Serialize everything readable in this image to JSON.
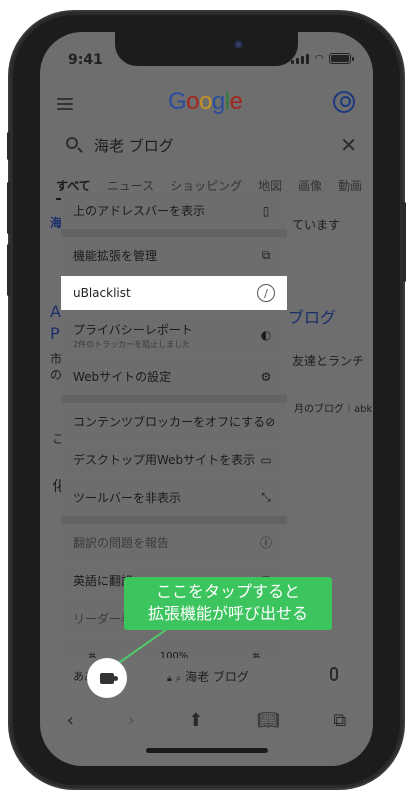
{
  "status": {
    "time": "9:41"
  },
  "header": {
    "logo_letters": [
      "G",
      "o",
      "o",
      "g",
      "l",
      "e"
    ],
    "logo_colors": [
      "#2b4c9e",
      "#a2261d",
      "#c5932a",
      "#2b4c9e",
      "#2e7a3a",
      "#a2261d"
    ]
  },
  "search": {
    "query": "海老 ブログ"
  },
  "tabs": [
    "すべて",
    "ニュース",
    "ショッピング",
    "地図",
    "画像",
    "動画"
  ],
  "background": {
    "line1": "ています",
    "line2": "ブログ",
    "line3": "友達とランチ",
    "line4": "月のブログ｜abk",
    "frag_a": "海",
    "frag_b": "A",
    "frag_c": "P",
    "frag_d": "市",
    "frag_e": "の",
    "frag_f": "こ",
    "frag_g": "化",
    "frag_h": "海"
  },
  "menu": {
    "items": [
      {
        "label": "上のアドレスバーを表示",
        "icon": "phone-icon"
      },
      {
        "label": "機能拡張を管理",
        "icon": "extension-icon"
      },
      {
        "label": "uBlacklist",
        "icon": "block-icon"
      },
      {
        "label": "プライバシーレポート",
        "sub": "2件のトラッカーを阻止しました",
        "icon": "shield-icon"
      },
      {
        "label": "Webサイトの設定",
        "icon": "settings-icon"
      },
      {
        "label": "コンテンツブロッカーをオフにする",
        "icon": "blocker-off-icon"
      },
      {
        "label": "デスクトップ用Webサイトを表示",
        "icon": "desktop-icon"
      },
      {
        "label": "ツールバーを非表示",
        "icon": "resize-icon"
      },
      {
        "label": "翻訳の問題を報告",
        "icon": "info-icon"
      },
      {
        "label": "英語に翻訳",
        "icon": "translate-icon"
      },
      {
        "label": "リーダー表示",
        "icon": "reader-icon"
      }
    ],
    "font_row": {
      "small": "あ",
      "zoom": "100%",
      "large": "あ"
    }
  },
  "callout": {
    "line1": "ここをタップすると",
    "line2": "拡張機能が呼び出せる"
  },
  "address_bar": {
    "aa": "ああ",
    "url": "海老 ブログ"
  },
  "colors": {
    "callout": "#3cc55f",
    "dim_overlay": "#6e6e6e",
    "selected_row": "#ffffff"
  }
}
